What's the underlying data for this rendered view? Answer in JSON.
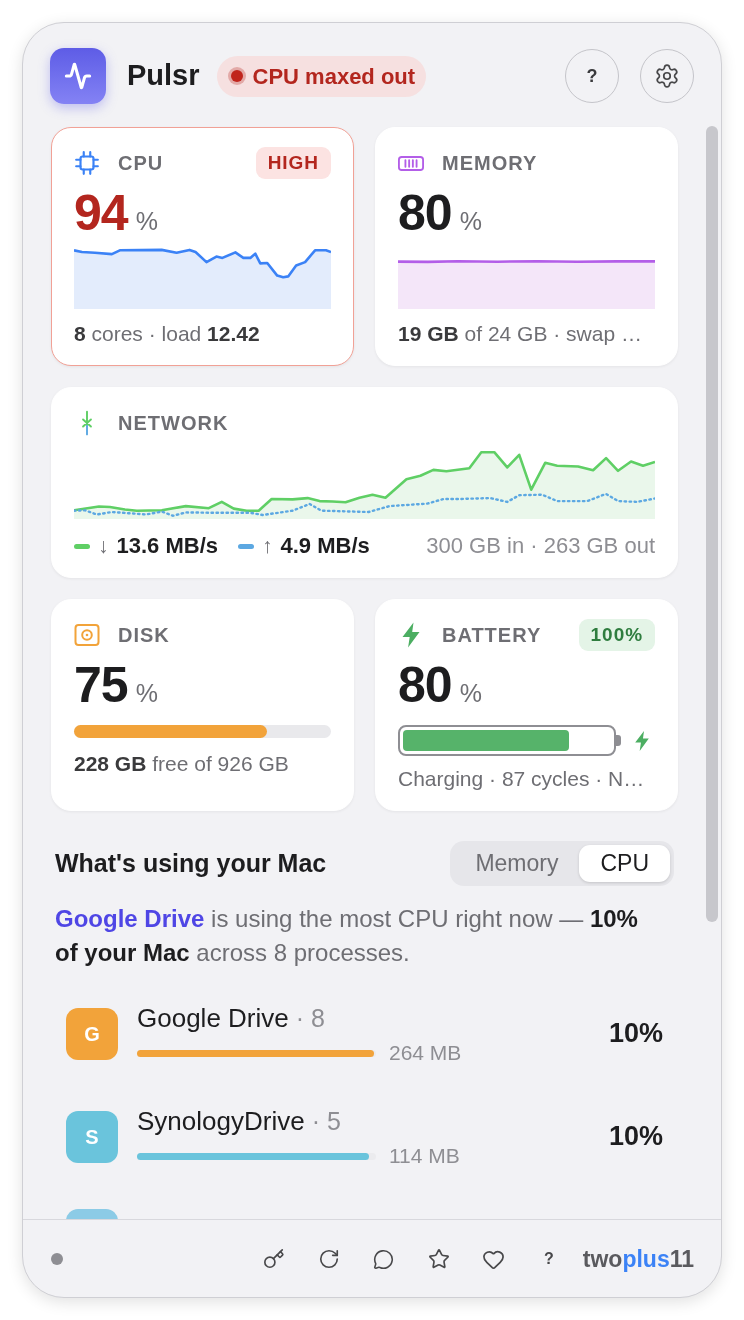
{
  "header": {
    "app_name": "Pulsr",
    "status": {
      "kind": "danger",
      "text": "CPU maxed out"
    },
    "help_label": "?"
  },
  "cards": [
    {
      "kind": "cpu",
      "title": "CPU",
      "badge": {
        "kind": "danger",
        "text": "HIGH"
      },
      "alert": true,
      "value": "94",
      "unit": "%",
      "footer": "**8** cores · load **12.42**"
    },
    {
      "kind": "memory",
      "title": "MEMORY",
      "alert": false,
      "value": "80",
      "unit": "%",
      "footer": "**19 GB** of 24 GB · swap …"
    },
    {
      "kind": "network",
      "title": "NETWORK",
      "legend": [
        {
          "arrow": "↓",
          "text": "13.6 MB/s",
          "color": "#5fcf65"
        },
        {
          "arrow": "↑",
          "text": "4.9 MB/s",
          "color": "#5ca8e2"
        }
      ],
      "totals": "300 GB in · 263 GB out"
    },
    {
      "kind": "disk",
      "title": "DISK",
      "alert": false,
      "value": "75",
      "unit": "%",
      "level": 0.75,
      "footer": "**228 GB** free of 926 GB"
    },
    {
      "kind": "battery",
      "title": "BATTERY",
      "badge": {
        "kind": "success",
        "text": "100%"
      },
      "alert": false,
      "value": "80",
      "unit": "%",
      "level": 0.8,
      "charging": true,
      "footer": "Charging · 87 cycles · N…"
    }
  ],
  "usage": {
    "title": "What's using your Mac",
    "tabs": [
      {
        "label": "Memory",
        "selected": false
      },
      {
        "label": "CPU",
        "selected": true
      }
    ],
    "summary": {
      "link": "Google Drive",
      "text": "is using the most CPU right now — **10% of your Mac** across 8 processes."
    },
    "processes": [
      {
        "initial": "G",
        "name": "Google Drive",
        "meta": "· 8",
        "color": "#f2a33a",
        "level": 0.99,
        "memory": "264 MB",
        "percent": "10%"
      },
      {
        "initial": "S",
        "name": "SynologyDrive",
        "meta": "· 5",
        "color": "#6ac4dc",
        "level": 0.97,
        "memory": "114 MB",
        "percent": "10%"
      },
      {
        "color": "#8ccbe6"
      }
    ]
  },
  "footer": {
    "help_label": "?",
    "logo": [
      {
        "text": "two",
        "accent": false
      },
      {
        "text": "plus",
        "accent": true
      },
      {
        "text": "11",
        "accent": false
      }
    ]
  }
}
